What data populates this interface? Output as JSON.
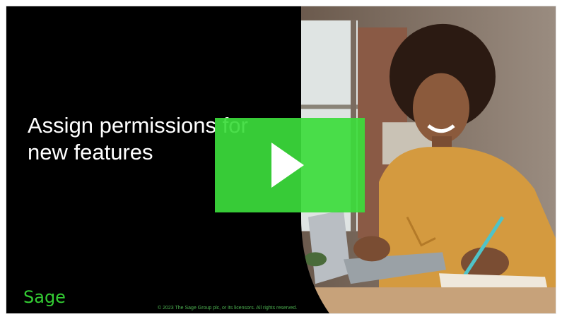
{
  "video": {
    "title_line1": "Assign permissions for",
    "title_line2": "new features",
    "brand": "Sage",
    "copyright": "© 2023 The Sage Group plc, or its licensors. All rights reserved.",
    "play_icon": "play-icon",
    "colors": {
      "background": "#000000",
      "play_button": "#3ddc3d",
      "brand_green": "#33cc33"
    }
  }
}
